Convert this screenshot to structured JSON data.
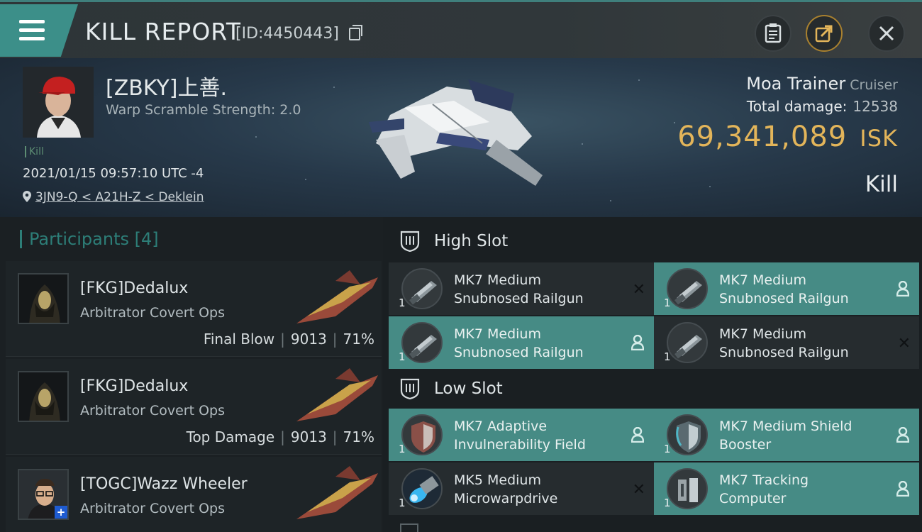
{
  "header": {
    "title": "KILL REPORT",
    "id_label": "[ID:4450443]"
  },
  "victim": {
    "name": "[ZBKY]上善.",
    "warp_scramble": "Warp Scramble Strength: 2.0",
    "kill_tag": "Kill",
    "datetime": "2021/01/15 09:57:10 UTC -4",
    "location": "3JN9-Q < A21H-Z < Deklein",
    "ship_name": "Moa Trainer",
    "ship_class": "Cruiser",
    "damage_label": "Total damage:",
    "damage_value": "12538",
    "isk_value": "69,341,089",
    "isk_unit": "ISK",
    "result": "Kill"
  },
  "participants": {
    "title": "Participants [4]",
    "items": [
      {
        "name": "[FKG]Dedalux",
        "ship": "Arbitrator Covert Ops",
        "role": "Final Blow",
        "damage": "9013",
        "percent": "71%"
      },
      {
        "name": "[FKG]Dedalux",
        "ship": "Arbitrator Covert Ops",
        "role": "Top Damage",
        "damage": "9013",
        "percent": "71%"
      },
      {
        "name": "[TOGC]Wazz Wheeler",
        "ship": "Arbitrator Covert Ops",
        "role": "",
        "damage": "",
        "percent": ""
      }
    ]
  },
  "slots": {
    "high": {
      "title": "High Slot",
      "modules": [
        {
          "line1": "MK7 Medium",
          "line2": "Snubnosed Railgun",
          "qty": "1",
          "state": "destroyed"
        },
        {
          "line1": "MK7 Medium",
          "line2": "Snubnosed Railgun",
          "qty": "1",
          "state": "dropped"
        },
        {
          "line1": "MK7 Medium",
          "line2": "Snubnosed Railgun",
          "qty": "1",
          "state": "dropped"
        },
        {
          "line1": "MK7 Medium",
          "line2": "Snubnosed Railgun",
          "qty": "1",
          "state": "destroyed"
        }
      ]
    },
    "low": {
      "title": "Low Slot",
      "modules": [
        {
          "line1": "MK7 Adaptive",
          "line2": "Invulnerability Field",
          "qty": "1",
          "state": "dropped"
        },
        {
          "line1": "MK7 Medium Shield",
          "line2": "Booster",
          "qty": "1",
          "state": "dropped"
        },
        {
          "line1": "MK5 Medium",
          "line2": "Microwarpdrive",
          "qty": "1",
          "state": "destroyed"
        },
        {
          "line1": "MK7 Tracking",
          "line2": "Computer",
          "qty": "1",
          "state": "dropped"
        }
      ]
    }
  },
  "colors": {
    "accent": "#3c8f89",
    "isk": "#e3b55a",
    "fitted_bg": "#468b85"
  }
}
